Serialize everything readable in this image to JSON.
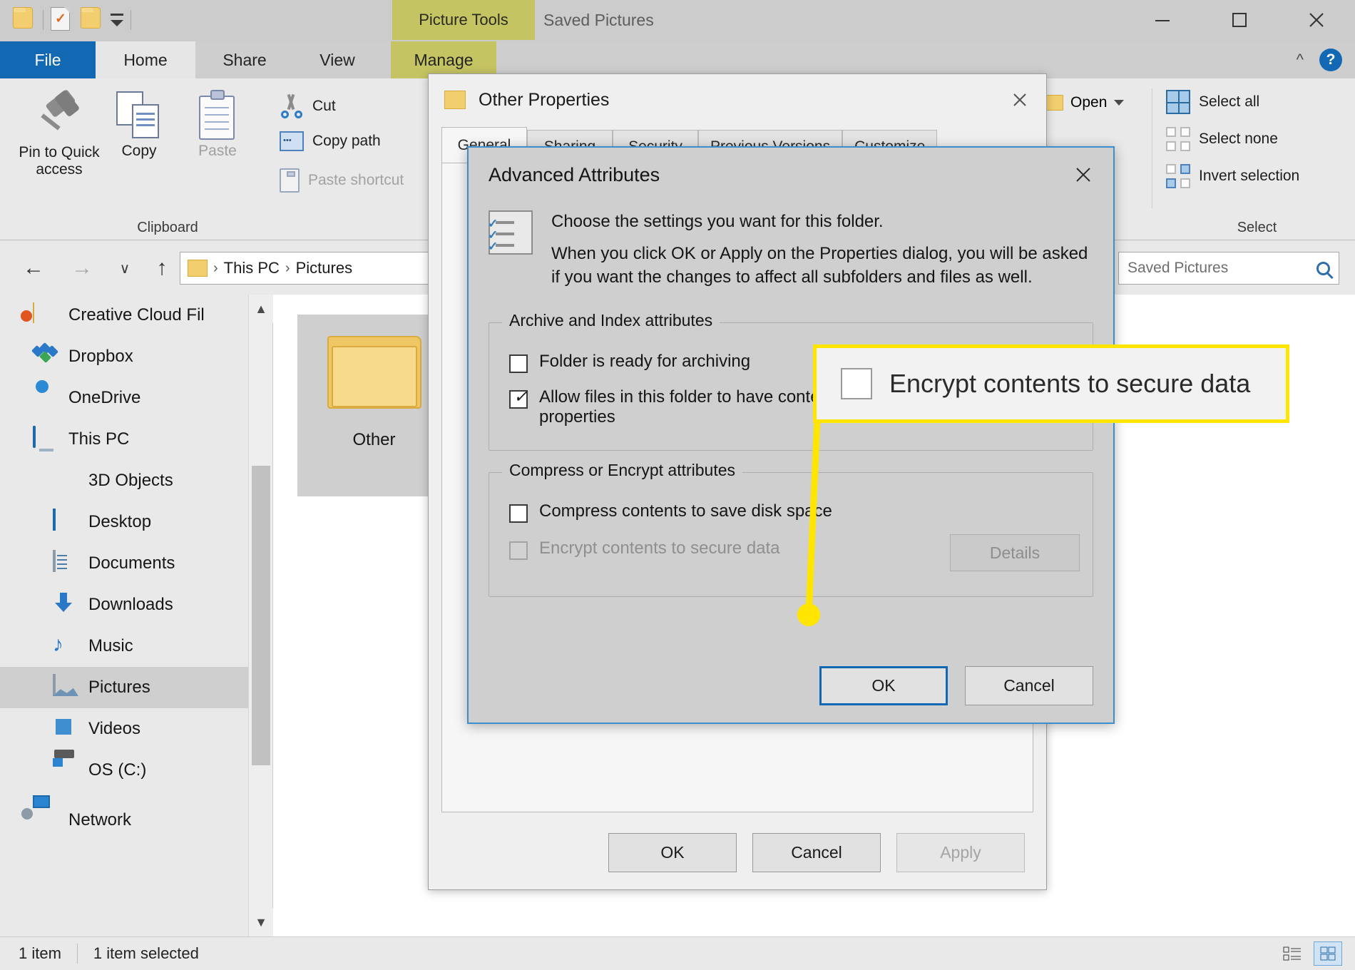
{
  "window": {
    "context_tab": "Picture Tools",
    "title": "Saved Pictures",
    "minimize": "Minimize",
    "maximize": "Maximize",
    "close": "Close"
  },
  "ribbon": {
    "tabs": [
      {
        "label": "File"
      },
      {
        "label": "Home"
      },
      {
        "label": "Share"
      },
      {
        "label": "View"
      },
      {
        "label": "Manage"
      }
    ],
    "clipboard": {
      "group_label": "Clipboard",
      "pin": "Pin to Quick access",
      "copy": "Copy",
      "paste": "Paste",
      "cut": "Cut",
      "copy_path": "Copy path",
      "paste_shortcut": "Paste shortcut"
    },
    "open_group": {
      "open": "Open"
    },
    "select": {
      "group_label": "Select",
      "select_all": "Select all",
      "select_none": "Select none",
      "invert_selection": "Invert selection"
    },
    "help": "?"
  },
  "addressbar": {
    "back": "←",
    "forward": "→",
    "recent": "∨",
    "up": "↑",
    "crumbs": [
      "This PC",
      "Pictures"
    ],
    "search_placeholder": "Saved Pictures"
  },
  "sidebar": {
    "items": [
      {
        "label": "Creative Cloud Fil",
        "icon": "creative-cloud-icon",
        "selected": false,
        "indent": 0
      },
      {
        "label": "Dropbox",
        "icon": "dropbox-icon",
        "selected": false,
        "indent": 0
      },
      {
        "label": "OneDrive",
        "icon": "onedrive-icon",
        "selected": false,
        "indent": 0
      },
      {
        "label": "This PC",
        "icon": "this-pc-icon",
        "selected": false,
        "indent": 0
      },
      {
        "label": "3D Objects",
        "icon": "3d-objects-icon",
        "selected": false,
        "indent": 1
      },
      {
        "label": "Desktop",
        "icon": "desktop-icon",
        "selected": false,
        "indent": 1
      },
      {
        "label": "Documents",
        "icon": "documents-icon",
        "selected": false,
        "indent": 1
      },
      {
        "label": "Downloads",
        "icon": "downloads-icon",
        "selected": false,
        "indent": 1
      },
      {
        "label": "Music",
        "icon": "music-icon",
        "selected": false,
        "indent": 1
      },
      {
        "label": "Pictures",
        "icon": "pictures-icon",
        "selected": true,
        "indent": 1
      },
      {
        "label": "Videos",
        "icon": "videos-icon",
        "selected": false,
        "indent": 1
      },
      {
        "label": "OS (C:)",
        "icon": "os-drive-icon",
        "selected": false,
        "indent": 1
      },
      {
        "label": "Network",
        "icon": "network-icon",
        "selected": false,
        "indent": 0
      }
    ]
  },
  "content": {
    "files": [
      {
        "name": "Other",
        "icon": "folder-icon"
      }
    ]
  },
  "statusbar": {
    "item_count": "1 item",
    "selection": "1 item selected"
  },
  "properties_dialog": {
    "title": "Other Properties",
    "close": "Close",
    "tabs": [
      {
        "label": "General"
      },
      {
        "label": "Sharing"
      },
      {
        "label": "Security"
      },
      {
        "label": "Previous Versions"
      },
      {
        "label": "Customize"
      }
    ],
    "buttons": {
      "ok": "OK",
      "cancel": "Cancel",
      "apply": "Apply"
    }
  },
  "advanced_attributes": {
    "title": "Advanced Attributes",
    "close": "Close",
    "intro_line1": "Choose the settings you want for this folder.",
    "intro_line2": "When you click OK or Apply on the Properties dialog, you will be asked if you want the changes to affect all subfolders and files as well.",
    "archive_section": {
      "legend": "Archive and Index attributes",
      "checkboxes": [
        {
          "label": "Folder is ready for archiving",
          "checked": false,
          "disabled": false
        },
        {
          "label": "Allow files in this folder to have contents indexed in addition to file properties",
          "checked": true,
          "disabled": false
        }
      ]
    },
    "compress_section": {
      "legend": "Compress or Encrypt attributes",
      "checkboxes": [
        {
          "label": "Compress contents to save disk space",
          "checked": false,
          "disabled": false
        },
        {
          "label": "Encrypt contents to secure data",
          "checked": false,
          "disabled": true
        }
      ],
      "details_button": "Details"
    },
    "buttons": {
      "ok": "OK",
      "cancel": "Cancel"
    }
  },
  "callout": {
    "label": "Encrypt contents to secure data",
    "highlight_color": "#ffe500"
  }
}
